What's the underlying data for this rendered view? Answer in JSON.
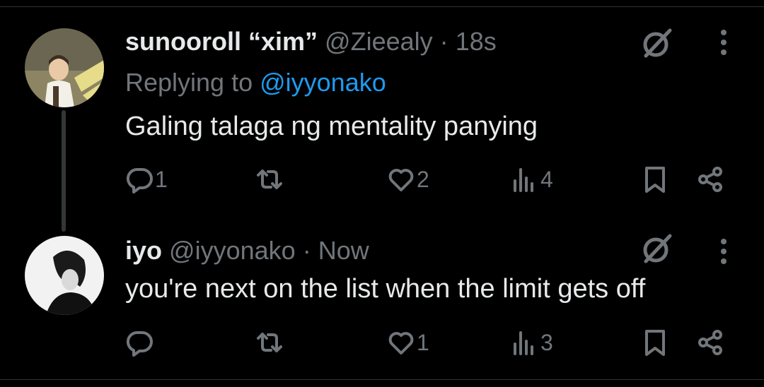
{
  "tweets": [
    {
      "name": "sunooroll “xim”",
      "handle": "@Zieealy",
      "sep": "·",
      "time": "18s",
      "reply_prefix": "Replying to ",
      "reply_mention": "@iyyonako",
      "text": "Galing talaga ng mentality panying",
      "replies": "1",
      "retweets": "",
      "likes": "2",
      "views": "4"
    },
    {
      "name": "iyo",
      "handle": "@iyyonako",
      "sep": "·",
      "time": "Now",
      "text": "you're next on the list when the limit gets off",
      "replies": "",
      "retweets": "",
      "likes": "1",
      "views": "3"
    }
  ],
  "icons": {
    "reply": "reply-icon",
    "retweet": "retweet-icon",
    "like": "heart-icon",
    "views": "views-icon",
    "bookmark": "bookmark-icon",
    "share": "share-icon",
    "grok": "grok-icon",
    "more": "more-icon"
  },
  "colors": {
    "background": "#000000",
    "text": "#e7e9ea",
    "muted": "#71767b",
    "link": "#1d9bf0"
  }
}
